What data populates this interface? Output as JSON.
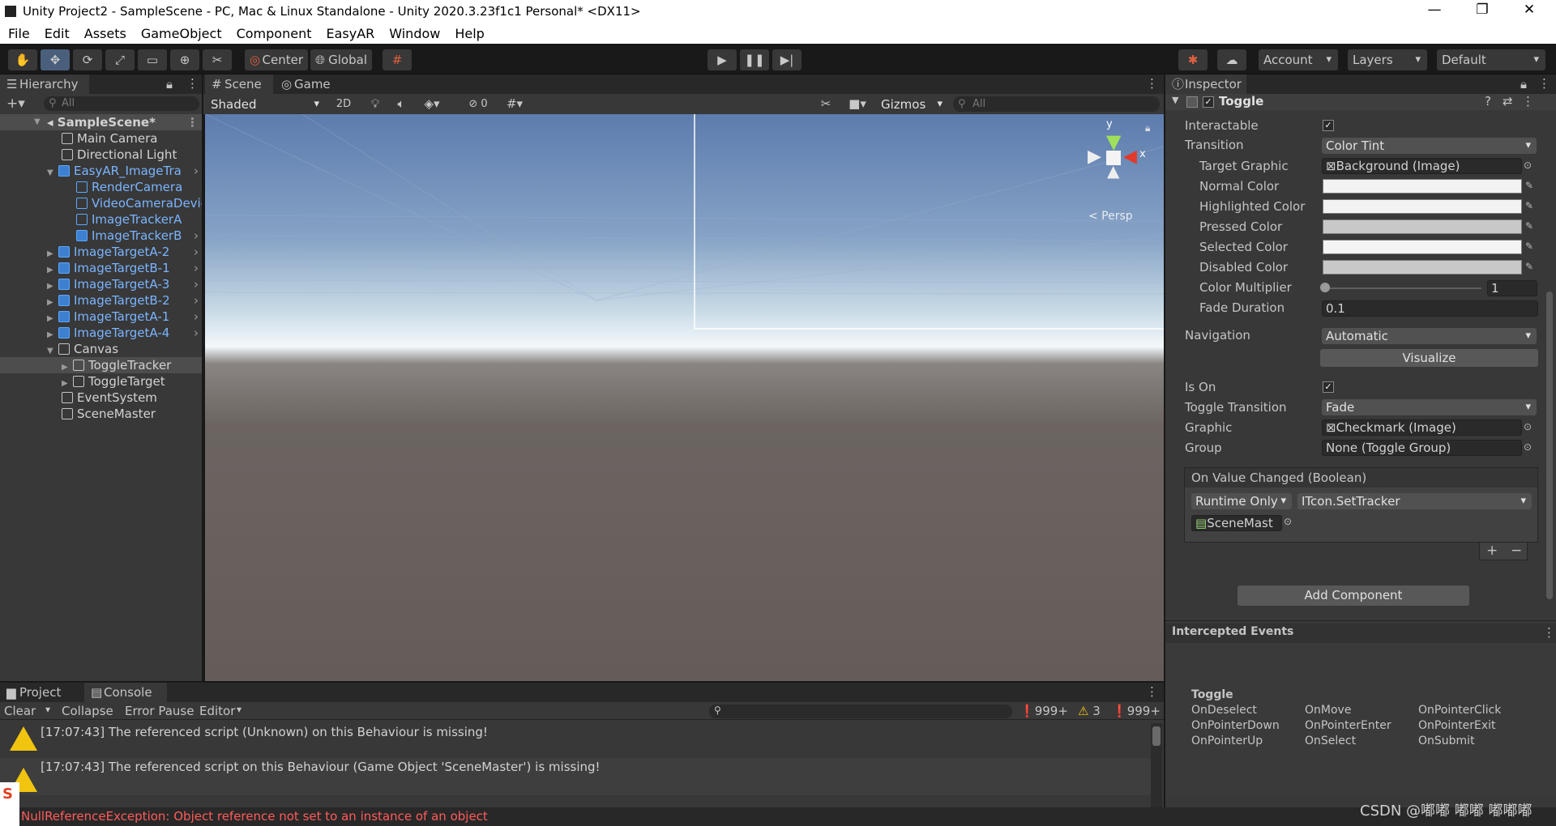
{
  "titlebar": {
    "title": "Unity Project2 - SampleScene - PC, Mac & Linux Standalone - Unity 2020.3.23f1c1 Personal* <DX11>"
  },
  "menu": [
    "File",
    "Edit",
    "Assets",
    "GameObject",
    "Component",
    "EasyAR",
    "Window",
    "Help"
  ],
  "toolbar": {
    "pivot": "Center",
    "space": "Global",
    "account": "Account",
    "layers": "Layers",
    "layout": "Default"
  },
  "hierarchy": {
    "tab": "Hierarchy",
    "search_placeholder": "All",
    "scene": "SampleScene*",
    "items": [
      {
        "label": "Main Camera"
      },
      {
        "label": "Directional Light"
      },
      {
        "label": "EasyAR_ImageTra"
      },
      {
        "label": "RenderCamera"
      },
      {
        "label": "VideoCameraDevic"
      },
      {
        "label": "ImageTrackerA"
      },
      {
        "label": "ImageTrackerB"
      },
      {
        "label": "ImageTargetA-2"
      },
      {
        "label": "ImageTargetB-1"
      },
      {
        "label": "ImageTargetA-3"
      },
      {
        "label": "ImageTargetB-2"
      },
      {
        "label": "ImageTargetA-1"
      },
      {
        "label": "ImageTargetA-4"
      },
      {
        "label": "Canvas"
      },
      {
        "label": "ToggleTracker"
      },
      {
        "label": "ToggleTarget"
      },
      {
        "label": "EventSystem"
      },
      {
        "label": "SceneMaster"
      }
    ]
  },
  "scene": {
    "tab_scene": "Scene",
    "tab_game": "Game",
    "shading": "Shaded",
    "mode2d": "2D",
    "hidden_count": "0",
    "gizmos": "Gizmos",
    "search_placeholder": "All",
    "persp": "< Persp",
    "axis_y": "y",
    "axis_x": "x"
  },
  "inspector": {
    "tab": "Inspector",
    "component": "Toggle",
    "interactable_label": "Interactable",
    "transition_label": "Transition",
    "transition_value": "Color Tint",
    "target_graphic_label": "Target Graphic",
    "target_graphic_value": "Background (Image)",
    "normal_color_label": "Normal Color",
    "highlighted_color_label": "Highlighted Color",
    "pressed_color_label": "Pressed Color",
    "selected_color_label": "Selected Color",
    "disabled_color_label": "Disabled Color",
    "color_multiplier_label": "Color Multiplier",
    "color_multiplier_value": "1",
    "fade_duration_label": "Fade Duration",
    "fade_duration_value": "0.1",
    "navigation_label": "Navigation",
    "navigation_value": "Automatic",
    "visualize": "Visualize",
    "is_on_label": "Is On",
    "toggle_transition_label": "Toggle Transition",
    "toggle_transition_value": "Fade",
    "graphic_label": "Graphic",
    "graphic_value": "Checkmark (Image)",
    "group_label": "Group",
    "group_value": "None (Toggle Group)",
    "event_header": "On Value Changed (Boolean)",
    "runtime": "Runtime Only",
    "method": "ITcon.SetTracker",
    "object": "SceneMast",
    "plus": "+",
    "minus": "−",
    "add_component": "Add Component",
    "intercepted_header": "Intercepted Events",
    "events_title": "Toggle",
    "events": [
      "OnDeselect",
      "OnMove",
      "OnPointerClick",
      "OnPointerDown",
      "OnPointerEnter",
      "OnPointerExit",
      "OnPointerUp",
      "OnSelect",
      "OnSubmit"
    ]
  },
  "console": {
    "tab_project": "Project",
    "tab_console": "Console",
    "clear": "Clear",
    "collapse": "Collapse",
    "error_pause": "Error Pause",
    "editor": "Editor",
    "count_info": "999+",
    "count_warn": "3",
    "count_error": "999+",
    "messages": [
      "[17:07:43] The referenced script (Unknown) on this Behaviour is missing!",
      "[17:07:43] The referenced script on this Behaviour (Game Object 'SceneMaster') is missing!"
    ],
    "status_error": "NullReferenceException: Object reference not set to an instance of an object"
  },
  "watermark": "CSDN @嘟嘟 嘟嘟 嘟嘟嘟",
  "colors": {
    "accent_blue": "#7ab4ff",
    "error_red": "#ff5b5b",
    "warn_yellow": "#f1c40f"
  }
}
